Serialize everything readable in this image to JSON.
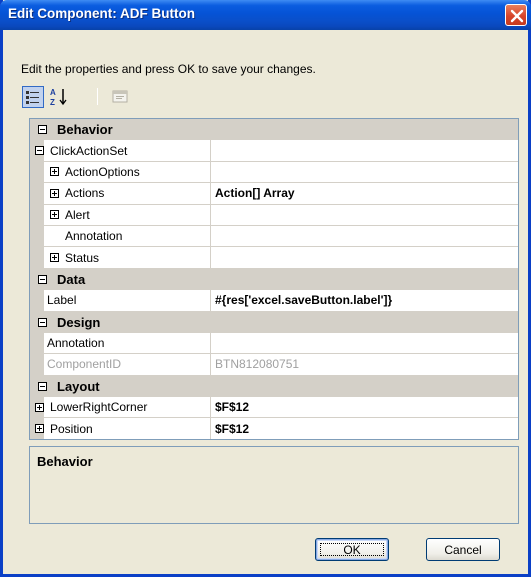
{
  "window": {
    "title": "Edit Component: ADF Button",
    "close_icon": "close-icon"
  },
  "instructions": "Edit the properties and press OK to save your changes.",
  "toolbar": {
    "categorized_icon": "categorized-view-icon",
    "alphabetical_icon": "alphabetical-sort-icon",
    "property_pages_icon": "property-pages-icon"
  },
  "property_grid": {
    "categories": [
      {
        "label": "Behavior",
        "properties": [
          {
            "name": "ClickActionSet",
            "value": "",
            "expander": "minus",
            "indent": 0
          },
          {
            "name": "ActionOptions",
            "value": "",
            "expander": "plus",
            "indent": 1
          },
          {
            "name": "Actions",
            "value": "Action[] Array",
            "expander": "plus",
            "indent": 1
          },
          {
            "name": "Alert",
            "value": "",
            "expander": "plus",
            "indent": 1
          },
          {
            "name": "Annotation",
            "value": "",
            "expander": "none",
            "indent": 1
          },
          {
            "name": "Status",
            "value": "",
            "expander": "plus",
            "indent": 1
          }
        ]
      },
      {
        "label": "Data",
        "properties": [
          {
            "name": "Label",
            "value": "#{res['excel.saveButton.label']}",
            "expander": "none",
            "indent": 0
          }
        ]
      },
      {
        "label": "Design",
        "properties": [
          {
            "name": "Annotation",
            "value": "",
            "expander": "none",
            "indent": 0
          },
          {
            "name": "ComponentID",
            "value": "BTN812080751",
            "expander": "none",
            "indent": 0,
            "disabled": true
          }
        ]
      },
      {
        "label": "Layout",
        "properties": [
          {
            "name": "LowerRightCorner",
            "value": "$F$12",
            "expander": "plus",
            "indent": 0
          },
          {
            "name": "Position",
            "value": "$F$12",
            "expander": "plus",
            "indent": 0
          }
        ]
      }
    ]
  },
  "description": {
    "title": "Behavior"
  },
  "buttons": {
    "ok_label": "OK",
    "cancel_label": "Cancel"
  }
}
